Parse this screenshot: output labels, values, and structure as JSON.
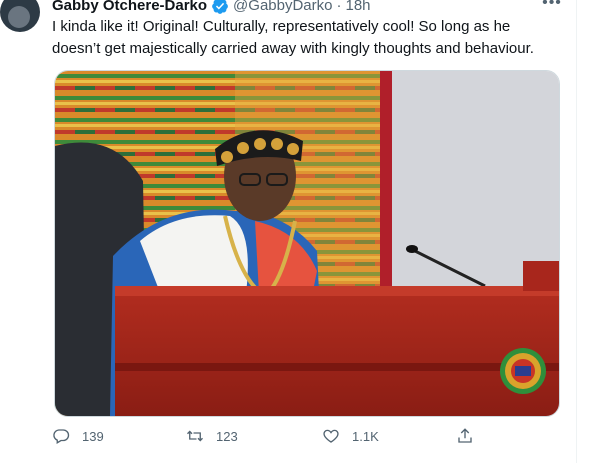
{
  "tweet": {
    "author_name": "Gabby Otchere-Darko",
    "handle": "@GabbyDarko",
    "separator": "·",
    "time": "18h",
    "text": "I kinda like it! Original! Culturally, representatively cool! So long as he doesn’t get majestically carried away with kingly thoughts and behaviour.",
    "more_label": "•••"
  },
  "icons": {
    "verified": "verified-badge-icon",
    "reply": "reply-icon",
    "retweet": "retweet-icon",
    "like": "like-icon",
    "share": "share-icon"
  },
  "actions": {
    "reply_count": "139",
    "retweet_count": "123",
    "like_count": "1.1K"
  },
  "colors": {
    "verified_blue": "#1d9bf0",
    "secondary_text": "#536471",
    "desk_red": "#a8261c"
  }
}
